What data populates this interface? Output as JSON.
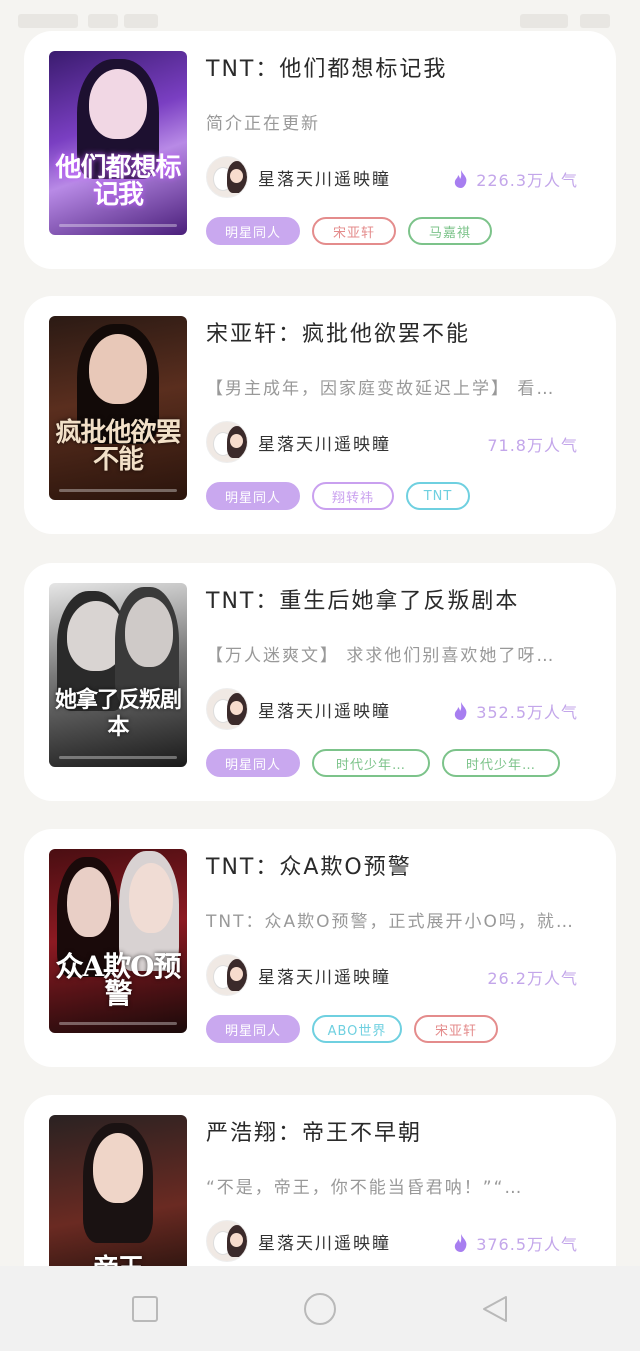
{
  "colors": {
    "background": "#f5f4f1",
    "card": "#ffffff",
    "accent": "#c9a8ef",
    "popularity": "#c3a6ea",
    "tag_red": "#e48c8c",
    "tag_green": "#7cc38a",
    "tag_purple": "#c9a0ef",
    "tag_cyan": "#6fd0e0"
  },
  "books": [
    {
      "title": "TNT：他们都想标记我",
      "intro": "简介正在更新",
      "author": "星落天川遥映瞳",
      "popularity": "226.3万人气",
      "show_flame": true,
      "cover_text": "他们都想标记我",
      "tags": [
        {
          "label": "明星同人",
          "style": "primary"
        },
        {
          "label": "宋亚轩",
          "style": "red"
        },
        {
          "label": "马嘉祺",
          "style": "green"
        }
      ]
    },
    {
      "title": "宋亚轩：疯批他欲罢不能",
      "intro": "【男主成年，因家庭变故延迟上学】 看…",
      "author": "星落天川遥映瞳",
      "popularity": "71.8万人气",
      "show_flame": false,
      "cover_text": "疯批他欲罢不能",
      "tags": [
        {
          "label": "明星同人",
          "style": "primary"
        },
        {
          "label": "翔转祎",
          "style": "purple"
        },
        {
          "label": "TNT",
          "style": "cyan"
        }
      ]
    },
    {
      "title": "TNT：重生后她拿了反叛剧本",
      "intro": "【万人迷爽文】 求求他们别喜欢她了呀…",
      "author": "星落天川遥映瞳",
      "popularity": "352.5万人气",
      "show_flame": true,
      "cover_text": "她拿了反叛剧本",
      "tags": [
        {
          "label": "明星同人",
          "style": "primary"
        },
        {
          "label": "时代少年…",
          "style": "green"
        },
        {
          "label": "时代少年…",
          "style": "green"
        }
      ]
    },
    {
      "title": "TNT：众A欺O预警",
      "intro": "TNT：众A欺O预警，正式展开小O吗，就…",
      "author": "星落天川遥映瞳",
      "popularity": "26.2万人气",
      "show_flame": false,
      "cover_text": "众A欺O预警",
      "tags": [
        {
          "label": "明星同人",
          "style": "primary"
        },
        {
          "label": "ABO世界",
          "style": "cyan"
        },
        {
          "label": "宋亚轩",
          "style": "red"
        }
      ]
    },
    {
      "title": "严浩翔：帝王不早朝",
      "intro": "“不是，帝王，你不能当昏君呐！”“…",
      "author": "星落天川遥映瞳",
      "popularity": "376.5万人气",
      "show_flame": true,
      "cover_text": "帝王",
      "tags": []
    }
  ],
  "navbar": {
    "recent_icon": "square-icon",
    "home_icon": "circle-icon",
    "back_icon": "triangle-back-icon"
  }
}
